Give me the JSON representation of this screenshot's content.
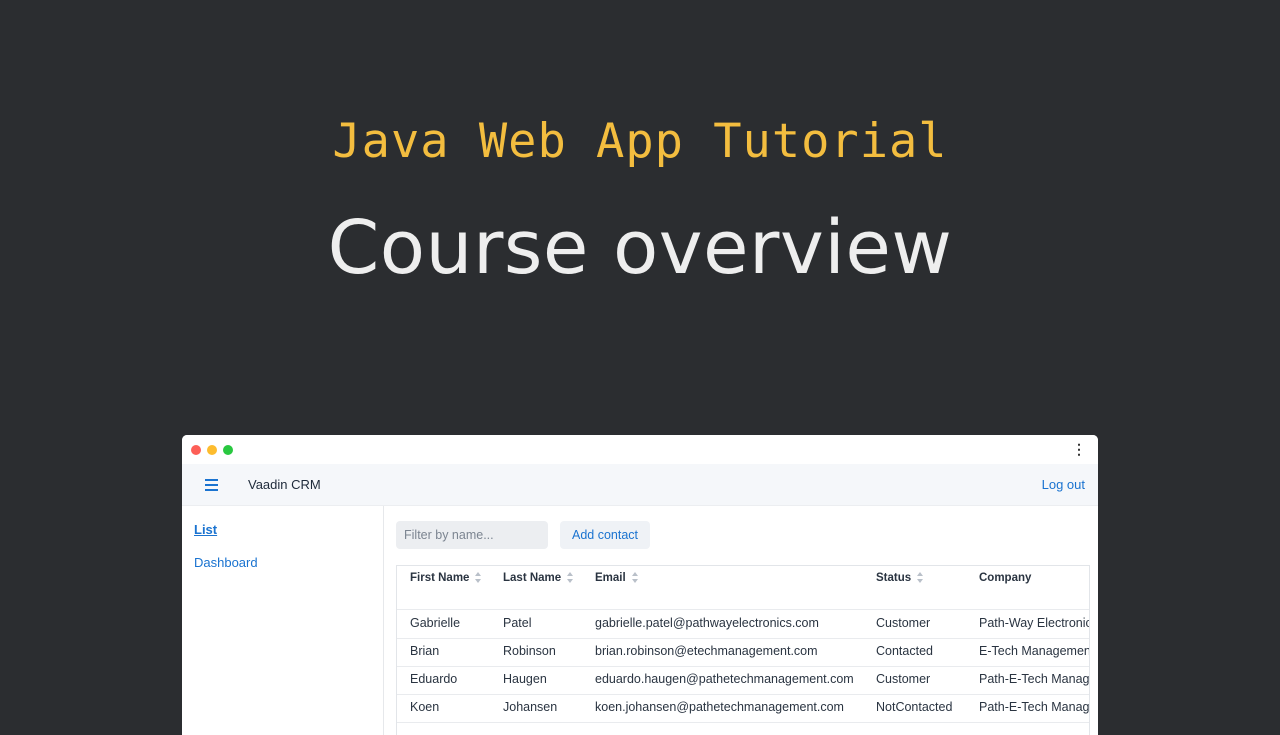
{
  "slide": {
    "subtitle": "Java Web App Tutorial",
    "title": "Course overview",
    "subtitle_color": "#f3bd3f",
    "background": "#2b2d30"
  },
  "app": {
    "title": "Vaadin CRM",
    "logout_label": "Log out",
    "drawer": [
      {
        "label": "List"
      },
      {
        "label": "Dashboard"
      }
    ],
    "toolbar": {
      "filter_placeholder": "Filter by name...",
      "add_label": "Add contact"
    },
    "grid": {
      "columns": [
        "First Name",
        "Last Name",
        "Email",
        "Status",
        "Company"
      ],
      "rows": [
        [
          "Gabrielle",
          "Patel",
          "gabrielle.patel@pathwayelectronics.com",
          "Customer",
          "Path-Way Electronics"
        ],
        [
          "Brian",
          "Robinson",
          "brian.robinson@etechmanagement.com",
          "Contacted",
          "E-Tech Management"
        ],
        [
          "Eduardo",
          "Haugen",
          "eduardo.haugen@pathetechmanagement.com",
          "Customer",
          "Path-E-Tech Management"
        ],
        [
          "Koen",
          "Johansen",
          "koen.johansen@pathetechmanagement.com",
          "NotContacted",
          "Path-E-Tech Management"
        ]
      ]
    },
    "accent_color": "#1a73d0"
  }
}
